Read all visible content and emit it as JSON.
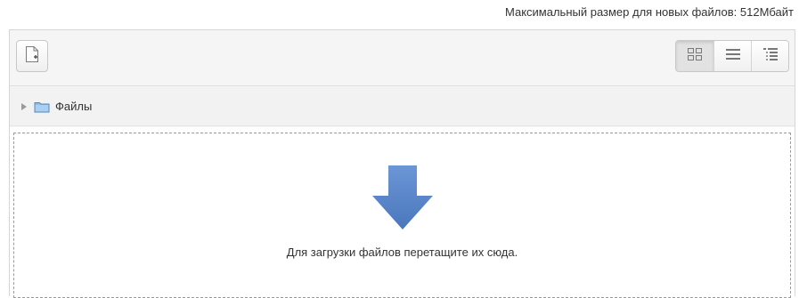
{
  "header": {
    "max_size_text": "Максимальный размер для новых файлов: 512Мбайт"
  },
  "toolbar": {
    "add_file_icon": "add-file-icon",
    "view_buttons": [
      {
        "icon": "icon-view-icon",
        "active": true
      },
      {
        "icon": "list-view-icon",
        "active": false
      },
      {
        "icon": "tree-view-icon",
        "active": false
      }
    ]
  },
  "path": {
    "folder_label": "Файлы",
    "folder_color": "#7fb3e0"
  },
  "dropzone": {
    "arrow_color": "#5a86c8",
    "text": "Для загрузки файлов перетащите их сюда."
  }
}
